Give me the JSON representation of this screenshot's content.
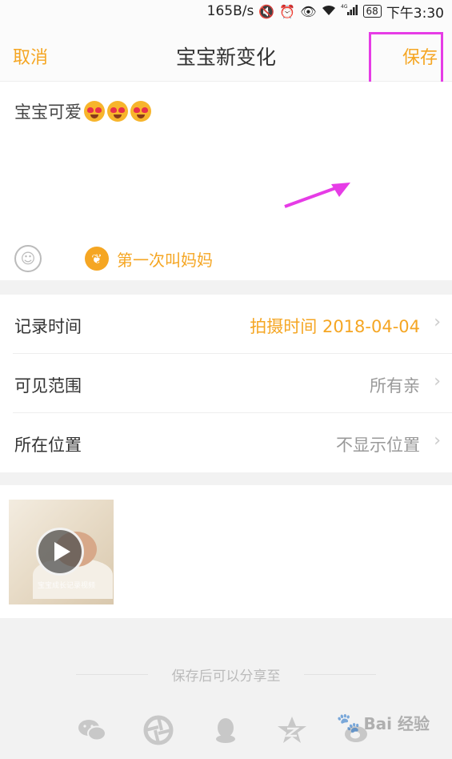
{
  "status_bar": {
    "speed": "165B/s",
    "icons": [
      "mute-icon",
      "alarm-icon",
      "eye-icon",
      "wifi-icon",
      "4g-signal-icon"
    ],
    "network": "4G",
    "battery": "68",
    "time": "下午3:30"
  },
  "nav": {
    "cancel_label": "取消",
    "title": "宝宝新变化",
    "save_label": "保存"
  },
  "editor": {
    "text": "宝宝可爱",
    "emoji_count": 3,
    "emoji_icon": "heart-eyes-emoji-icon",
    "emoji_button_icon": "smiley-icon",
    "milestone_icon": "sprout-icon",
    "milestone_label": "第一次叫妈妈"
  },
  "settings": {
    "rows": [
      {
        "label": "记录时间",
        "value": "拍摄时间 2018-04-04",
        "accent": true
      },
      {
        "label": "可见范围",
        "value": "所有亲",
        "accent": false
      },
      {
        "label": "所在位置",
        "value": "不显示位置",
        "accent": false
      }
    ]
  },
  "media": {
    "thumb_caption": "宝宝成长记录视频",
    "play_icon": "play-icon"
  },
  "share": {
    "hint": "保存后可以分享至",
    "targets": [
      "wechat-icon",
      "moments-icon",
      "qq-icon",
      "qzone-icon",
      "weibo-icon"
    ]
  },
  "watermark": {
    "text": "Bai 经验"
  },
  "colors": {
    "accent": "#f5a623",
    "highlight": "#e63ce6",
    "background": "#f2f2f2"
  }
}
